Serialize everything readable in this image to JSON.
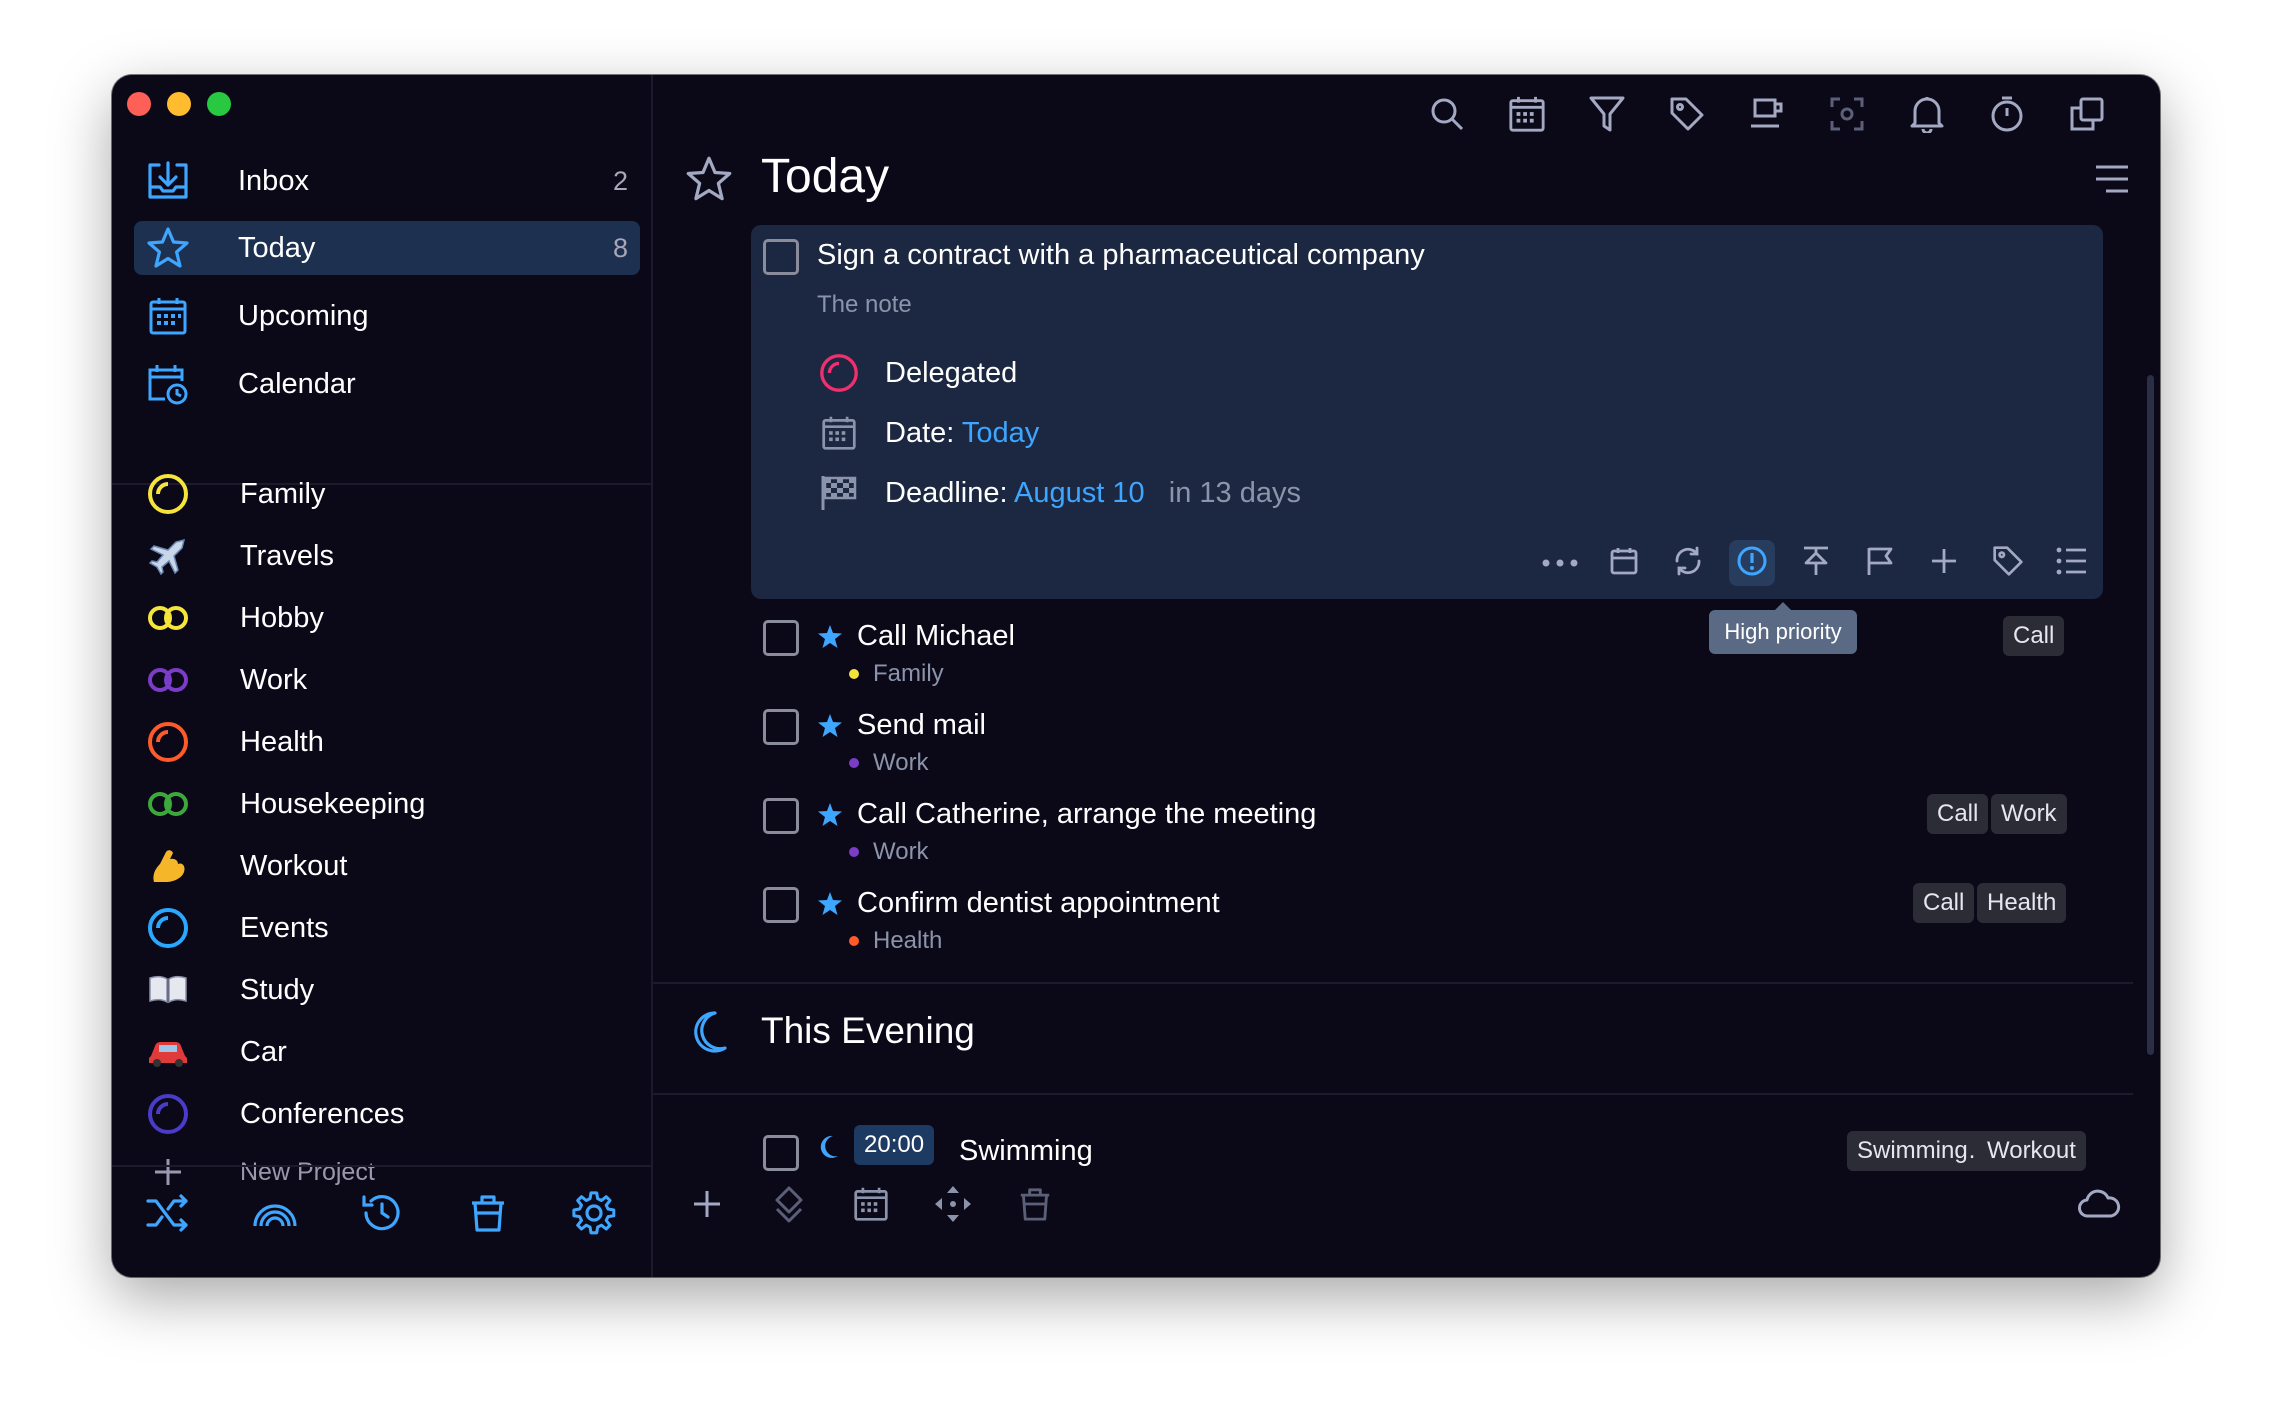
{
  "sidebar": {
    "nav": [
      {
        "label": "Inbox",
        "count": "2",
        "icon": "inbox-icon"
      },
      {
        "label": "Today",
        "count": "8",
        "icon": "star-icon"
      },
      {
        "label": "Upcoming",
        "count": "",
        "icon": "calendar-grid-icon"
      },
      {
        "label": "Calendar",
        "count": "",
        "icon": "calendar-clock-icon"
      }
    ],
    "projects": [
      {
        "label": "Family",
        "color": "#f5e43a",
        "icon": "ring-icon"
      },
      {
        "label": "Travels",
        "color": "#9ab0d0",
        "icon": "airplane-icon"
      },
      {
        "label": "Hobby",
        "color": "#f5e43a",
        "icon": "double-ring-icon"
      },
      {
        "label": "Work",
        "color": "#7b3cc8",
        "icon": "double-ring-icon"
      },
      {
        "label": "Health",
        "color": "#ff5a2a",
        "icon": "ring-icon"
      },
      {
        "label": "Housekeeping",
        "color": "#3ca83c",
        "icon": "double-ring-icon"
      },
      {
        "label": "Workout",
        "color": "#f5b62a",
        "icon": "flexed-biceps-icon"
      },
      {
        "label": "Events",
        "color": "#2aa8ff",
        "icon": "ring-icon"
      },
      {
        "label": "Study",
        "color": "#d0d4e0",
        "icon": "open-book-icon"
      },
      {
        "label": "Car",
        "color": "#e03a3a",
        "icon": "car-icon"
      },
      {
        "label": "Conferences",
        "color": "#4a3cc8",
        "icon": "ring-icon"
      }
    ],
    "new_project": "New Project"
  },
  "main": {
    "title": "Today",
    "expanded_task": {
      "title": "Sign a contract with a pharmaceutical company",
      "note": "The note",
      "status": "Delegated",
      "date_label": "Date:",
      "date_value": "Today",
      "deadline_label": "Deadline:",
      "deadline_value": "August 10",
      "deadline_relative": "in 13 days"
    },
    "tooltip": "High priority",
    "tasks": [
      {
        "title": "Call Michael",
        "project": "Family",
        "project_color": "#f5e43a",
        "tags": [
          "Call"
        ]
      },
      {
        "title": "Send mail",
        "project": "Work",
        "project_color": "#7b3cc8",
        "tags": []
      },
      {
        "title": "Call Catherine, arrange the meeting",
        "project": "Work",
        "project_color": "#7b3cc8",
        "tags": [
          "Call",
          "Work"
        ]
      },
      {
        "title": "Confirm dentist appointment",
        "project": "Health",
        "project_color": "#ff5a2a",
        "tags": [
          "Call",
          "Health"
        ]
      }
    ],
    "evening": {
      "title": "This Evening",
      "task": {
        "time": "20:00",
        "title": "Swimming",
        "tags": [
          "Swimming…",
          "Workout"
        ]
      }
    }
  },
  "colors": {
    "accent": "#3ea6ff",
    "background": "#0b0818",
    "active_item": "#1d3050",
    "expanded_card": "#1c2841"
  }
}
